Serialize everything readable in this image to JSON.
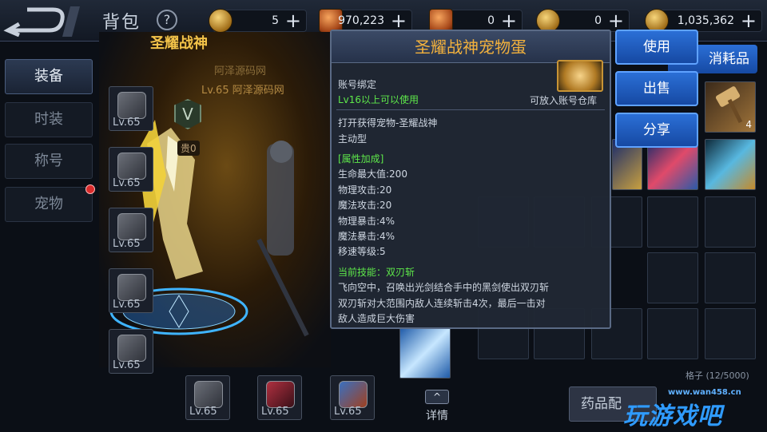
{
  "header": {
    "title": "背包",
    "help": "?",
    "resources": [
      {
        "icon": "coin-gold-icon",
        "value": "5",
        "plus": "+"
      },
      {
        "icon": "ticket-icon",
        "value": "970,223",
        "plus": "+"
      },
      {
        "icon": "scroll-icon",
        "value": "0",
        "plus": "+"
      },
      {
        "icon": "coin-icon",
        "value": "0",
        "plus": "+"
      },
      {
        "icon": "gold-coin-icon",
        "value": "1,035,362",
        "plus": "+"
      }
    ]
  },
  "nav": {
    "items": [
      {
        "label": "装备",
        "active": true
      },
      {
        "label": "时装",
        "active": false
      },
      {
        "label": "称号",
        "active": false
      },
      {
        "label": "宠物",
        "active": false,
        "badge": true
      }
    ]
  },
  "character": {
    "name": "圣耀战神",
    "guild": "阿泽源码网",
    "level": "Lv.65 阿泽源码网",
    "vip": "V",
    "rank": "贵0"
  },
  "equipment": {
    "left_slots": [
      "Lv.65",
      "Lv.65",
      "Lv.65",
      "Lv.65",
      "Lv.65"
    ],
    "bottom_slots": [
      "Lv.65",
      "Lv.65",
      "Lv.65"
    ]
  },
  "tooltip": {
    "title": "圣耀战神宠物蛋",
    "binding": "账号绑定",
    "requirement": "Lv16以上可以使用",
    "storage": "可放入账号仓库",
    "desc_line1": "打开获得宠物-圣耀战神",
    "desc_line2": "主动型",
    "attr_header": "[属性加成]",
    "attrs": [
      "生命最大值:200",
      "物理攻击:20",
      "魔法攻击:20",
      "物理暴击:4%",
      "魔法暴击:4%",
      "移速等级:5"
    ],
    "skill_header": "当前技能：双刃斩",
    "skill_lines": [
      "飞向空中，召唤出光剑结合手中的黑剑使出双刃斩",
      "双刃斩对大范围内敌人连续斩击4次，最后一击对",
      "敌人造成巨大伤害"
    ]
  },
  "actions": {
    "use": "使用",
    "sell": "出售",
    "share": "分享"
  },
  "inventory": {
    "consume_tab": "消耗品",
    "hammer_count": "4",
    "capacity": "格子 (12/5000)",
    "potion_button": "药品配",
    "detail_button": "详情",
    "detail_chevron": "^"
  },
  "watermark": {
    "url": "www.wan458.cn",
    "text": "玩游戏吧"
  }
}
